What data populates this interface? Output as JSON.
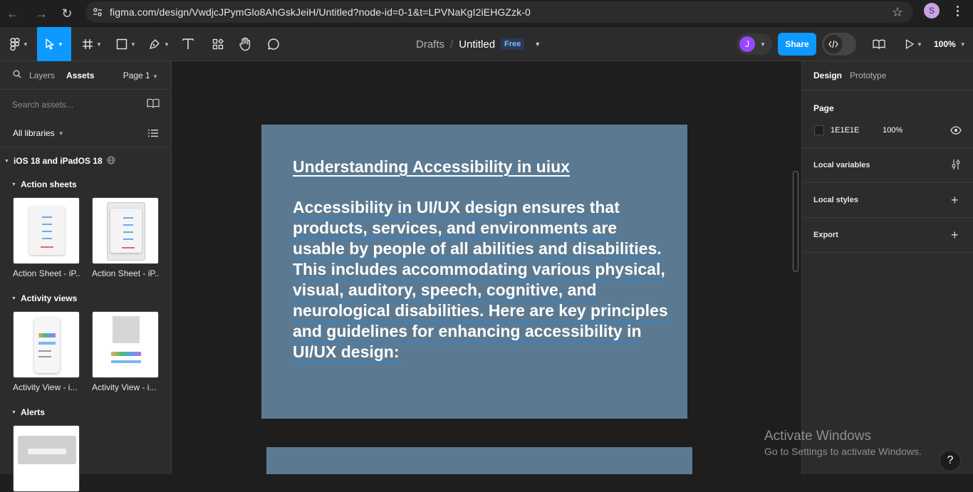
{
  "browser": {
    "url": "figma.com/design/VwdjcJPymGlo8AhGskJeiH/Untitled?node-id=0-1&t=LPVNaKgI2iEHGZzk-0",
    "profile_letter": "S"
  },
  "toolbar": {
    "breadcrumb_drafts": "Drafts",
    "breadcrumb_sep": "/",
    "file_title": "Untitled",
    "plan_badge": "Free",
    "avatar_letter": "J",
    "share_label": "Share",
    "zoom": "100%"
  },
  "left_panel": {
    "tabs": [
      "Layers",
      "Assets"
    ],
    "active_tab": "Assets",
    "page_label": "Page 1",
    "search_placeholder": "Search assets...",
    "libraries_label": "All libraries",
    "library_name": "iOS 18 and iPadOS 18",
    "sections": [
      {
        "title": "Action sheets",
        "items": [
          "Action Sheet - iP...",
          "Action Sheet - iP..."
        ]
      },
      {
        "title": "Activity views",
        "items": [
          "Activity View - i...",
          "Activity View - i..."
        ]
      },
      {
        "title": "Alerts",
        "items": [
          ""
        ]
      }
    ]
  },
  "canvas": {
    "frame_title": "Understanding Accessibility in uiux",
    "frame_body": "Accessibility in UI/UX design ensures that products, services, and environments are usable by people of all abilities and disabilities. This includes accommodating various physical, visual, auditory, speech, cognitive, and neurological disabilities. Here are key principles and guidelines for enhancing accessibility in UI/UX design:",
    "frame_color": "#5b7a92",
    "accent": "#0d99ff"
  },
  "right_panel": {
    "tabs": [
      "Design",
      "Prototype"
    ],
    "active_tab": "Design",
    "page_section_title": "Page",
    "page_color_hex": "1E1E1E",
    "page_opacity": "100%",
    "rows": [
      "Local variables",
      "Local styles",
      "Export"
    ]
  },
  "watermark": {
    "line1": "Activate Windows",
    "line2": "Go to Settings to activate Windows."
  },
  "help_label": "?"
}
